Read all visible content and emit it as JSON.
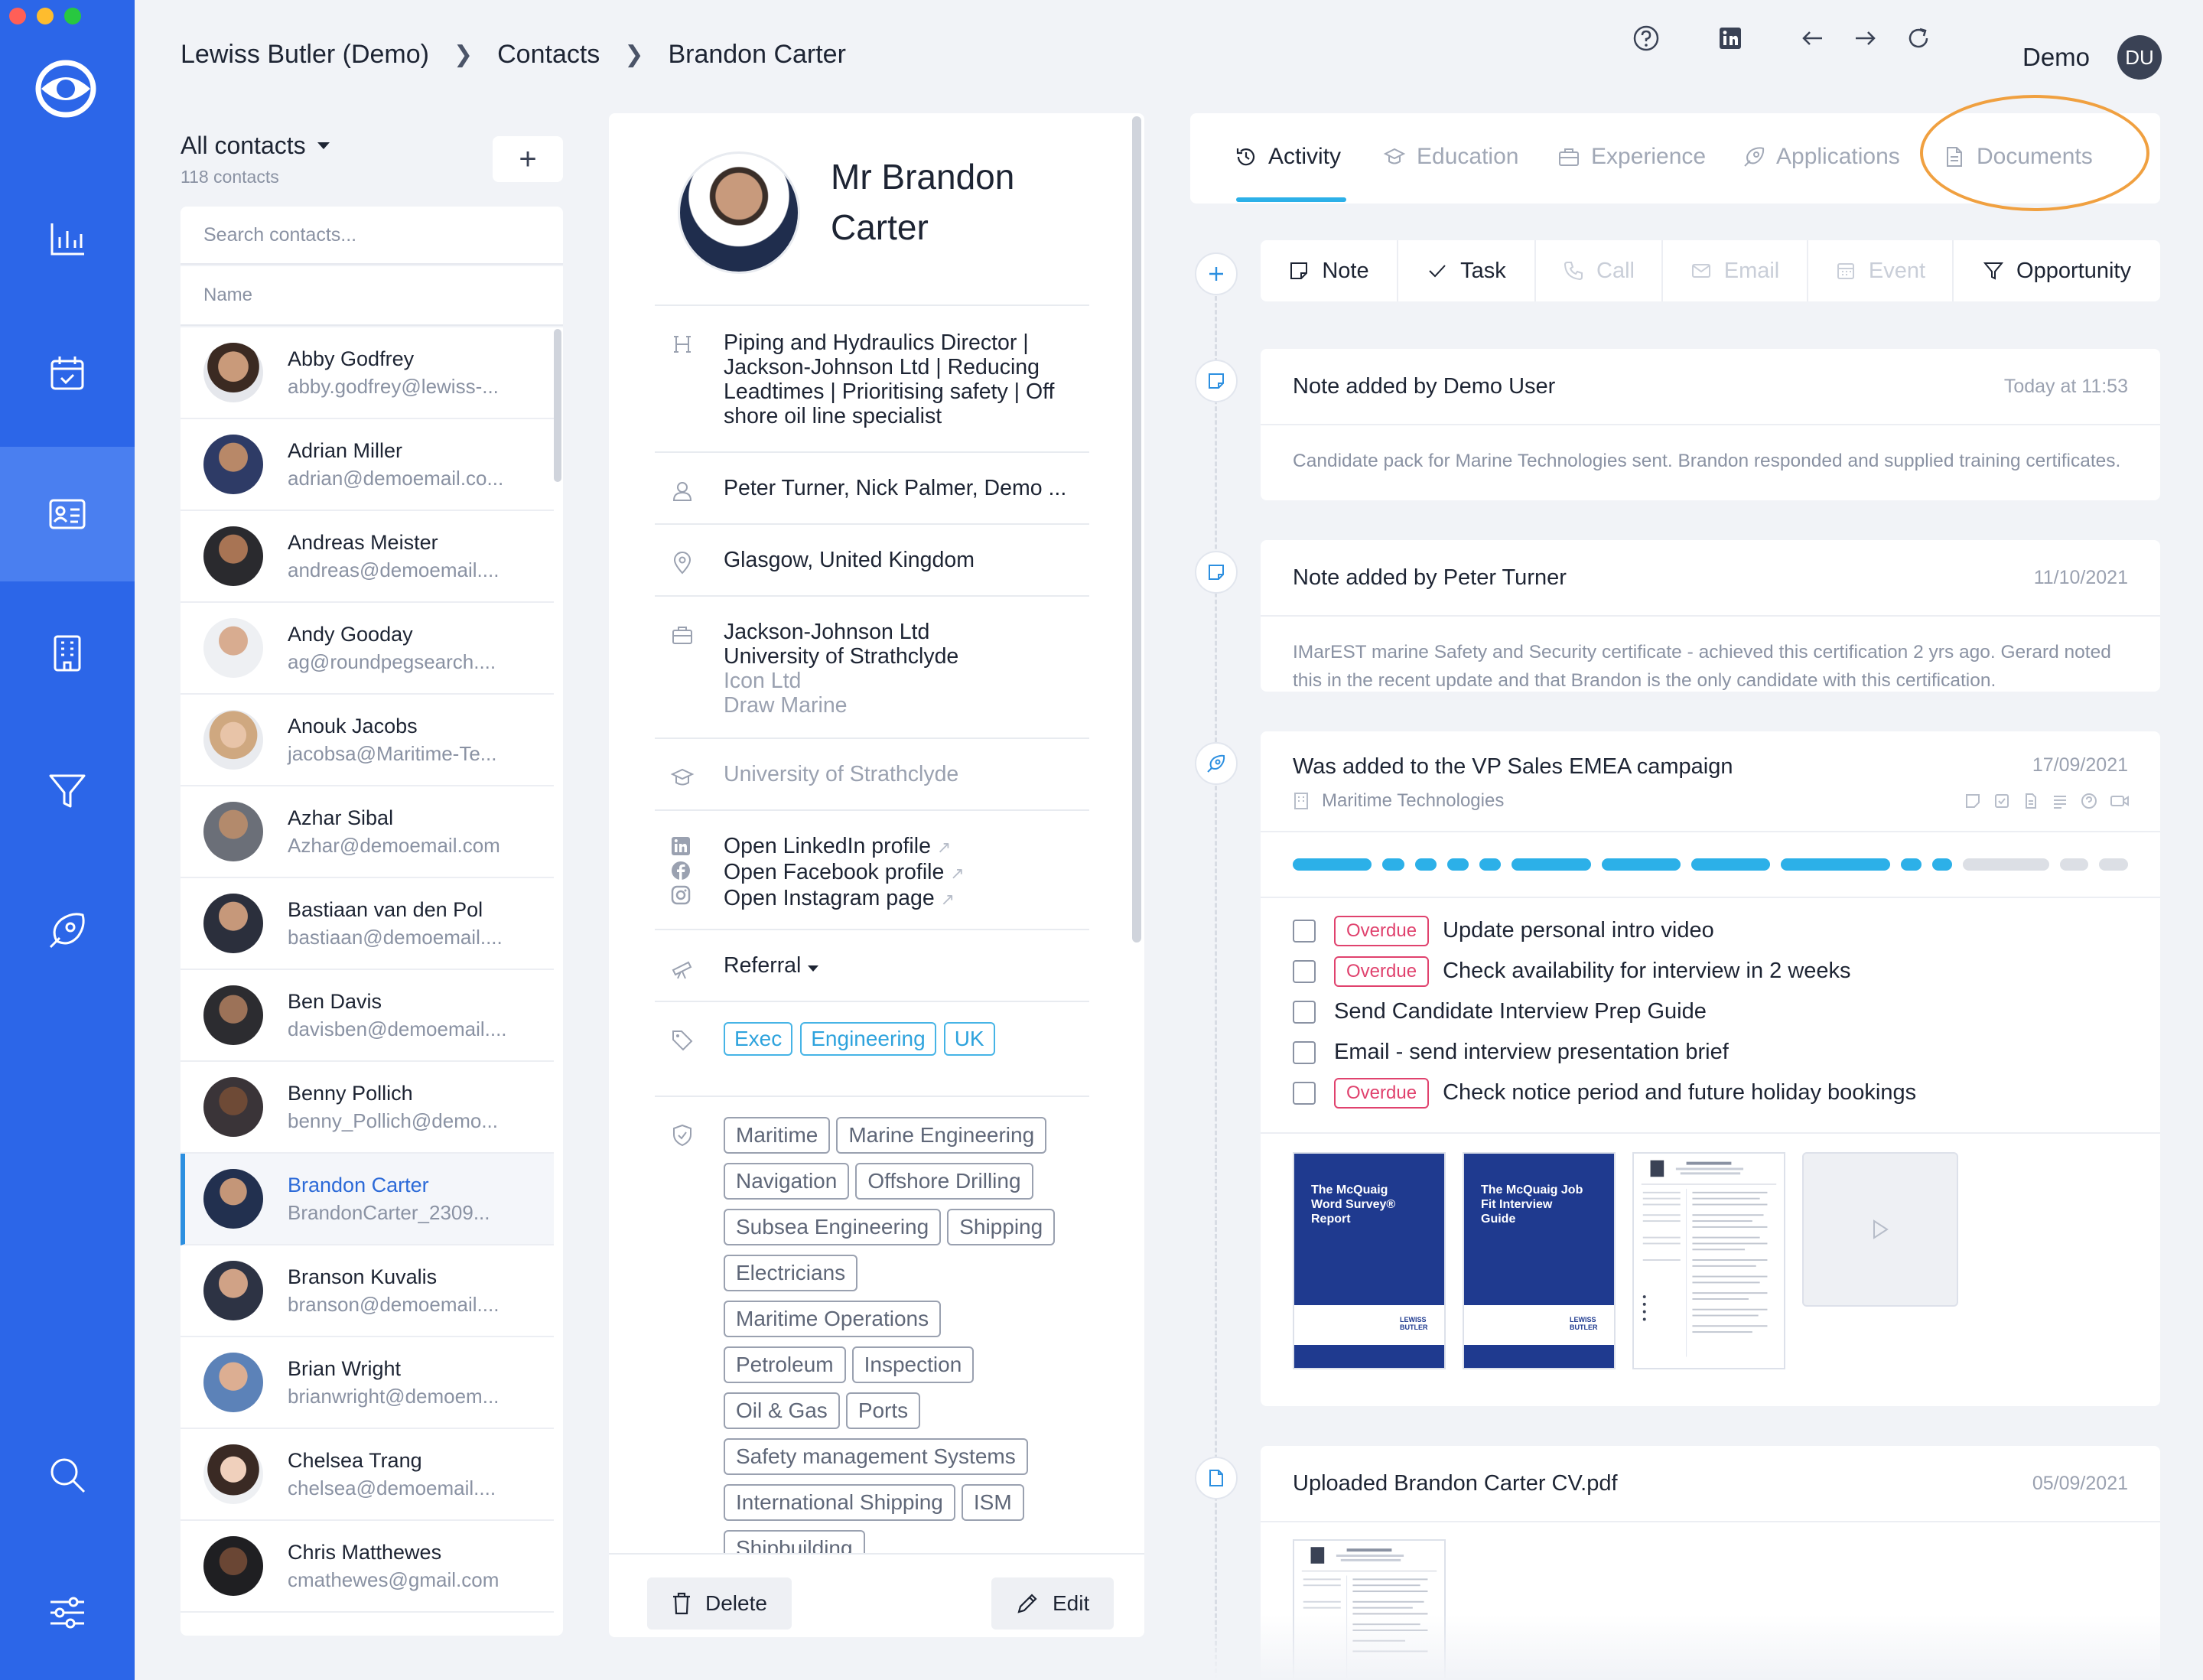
{
  "window_controls": {
    "close": "#ff5f57",
    "minimize": "#febc2e",
    "zoom": "#28c840"
  },
  "colors": {
    "rail": "#2c66e8",
    "rail_active": "#4a7ff0",
    "accent": "#2cb0e8",
    "overdue": "#e0426e",
    "highlight": "#f0a040"
  },
  "nav": [
    "logo-eye-icon",
    "reports-icon",
    "calendar-icon",
    "contacts-icon",
    "companies-icon",
    "pipeline-icon",
    "campaigns-icon",
    "search-icon",
    "settings-icon"
  ],
  "breadcrumb": {
    "account": "Lewiss Butler (Demo)",
    "section": "Contacts",
    "current": "Brandon Carter"
  },
  "topbar": {
    "user_label": "Demo",
    "user_initials": "DU"
  },
  "contacts": {
    "title": "All contacts",
    "count": "118 contacts",
    "add_label": "+",
    "search_placeholder": "Search contacts...",
    "column": "Name",
    "rows": [
      {
        "name": "Abby Godfrey",
        "email": "abby.godfrey@lewiss-..."
      },
      {
        "name": "Adrian Miller",
        "email": "adrian@demoemail.co..."
      },
      {
        "name": "Andreas Meister",
        "email": "andreas@demoemail...."
      },
      {
        "name": "Andy Gooday",
        "email": "ag@roundpegsearch...."
      },
      {
        "name": "Anouk Jacobs",
        "email": "jacobsa@Maritime-Te..."
      },
      {
        "name": "Azhar Sibal",
        "email": "Azhar@demoemail.com"
      },
      {
        "name": "Bastiaan van den Pol",
        "email": "bastiaan@demoemail...."
      },
      {
        "name": "Ben Davis",
        "email": "davisben@demoemail...."
      },
      {
        "name": "Benny Pollich",
        "email": "benny_Pollich@demo..."
      },
      {
        "name": "Brandon Carter",
        "email": "BrandonCarter_2309..."
      },
      {
        "name": "Branson Kuvalis",
        "email": "branson@demoemail...."
      },
      {
        "name": "Brian Wright",
        "email": "brianwright@demoem..."
      },
      {
        "name": "Chelsea Trang",
        "email": "chelsea@demoemail...."
      },
      {
        "name": "Chris Matthewes",
        "email": "cmathewes@gmail.com"
      }
    ]
  },
  "profile": {
    "name": "Mr Brandon Carter",
    "headline": "Piping and Hydraulics Director | Jackson-Johnson Ltd | Reducing Leadtimes | Prioritising safety | Off shore oil line specialist",
    "owners": "Peter Turner, Nick Palmer, Demo ...",
    "location": "Glasgow, United Kingdom",
    "companies": {
      "current": [
        "Jackson-Johnson Ltd",
        "University of Strathclyde"
      ],
      "past": [
        "Icon Ltd",
        "Draw Marine"
      ]
    },
    "education": "University of Strathclyde",
    "links": [
      "Open LinkedIn profile",
      "Open Facebook profile",
      "Open Instagram page"
    ],
    "source": "Referral",
    "tags": [
      "Exec",
      "Engineering",
      "UK"
    ],
    "skills": [
      "Maritime",
      "Marine Engineering",
      "Navigation",
      "Offshore Drilling",
      "Subsea Engineering",
      "Shipping",
      "Electricians",
      "Maritime Operations",
      "Petroleum",
      "Inspection",
      "Oil & Gas",
      "Ports",
      "Safety management Systems",
      "International Shipping",
      "ISM",
      "Shipbuilding"
    ],
    "delete_label": "Delete",
    "edit_label": "Edit"
  },
  "tabs": [
    {
      "label": "Activity",
      "icon": "history-icon",
      "active": true
    },
    {
      "label": "Education",
      "icon": "graduation-icon",
      "active": false
    },
    {
      "label": "Experience",
      "icon": "briefcase-icon",
      "active": false
    },
    {
      "label": "Applications",
      "icon": "rocket-icon",
      "active": false
    },
    {
      "label": "Documents",
      "icon": "document-icon",
      "active": false
    }
  ],
  "actions": [
    {
      "label": "Note",
      "enabled": true
    },
    {
      "label": "Task",
      "enabled": true
    },
    {
      "label": "Call",
      "enabled": false
    },
    {
      "label": "Email",
      "enabled": false
    },
    {
      "label": "Event",
      "enabled": false
    },
    {
      "label": "Opportunity",
      "enabled": true
    }
  ],
  "activity": {
    "note1": {
      "title": "Note added by Demo User",
      "date": "Today at 11:53",
      "body": "Candidate pack for Marine Technologies sent. Brandon responded and supplied training certificates."
    },
    "note2": {
      "title": "Note added by Peter Turner",
      "date": "11/10/2021",
      "body": "IMarEST marine Safety and Security certificate - achieved this certification 2 yrs ago. Gerard noted this in the recent update and that Brandon is the only candidate with this certification."
    },
    "campaign": {
      "title": "Was added to the VP Sales EMEA campaign",
      "date": "17/09/2021",
      "company": "Maritime Technologies",
      "progress_done": 11,
      "progress_total": 15,
      "overdue_label": "Overdue",
      "tasks": [
        {
          "label": "Update personal intro video",
          "overdue": true
        },
        {
          "label": "Check availability for interview in 2 weeks",
          "overdue": true
        },
        {
          "label": "Send Candidate Interview Prep Guide",
          "overdue": false
        },
        {
          "label": "Email - send interview presentation brief",
          "overdue": false
        },
        {
          "label": "Check notice period and future holiday bookings",
          "overdue": true
        }
      ],
      "docs": [
        {
          "title": "The McQuaig Word Survey® Report"
        },
        {
          "title": "The McQuaig Job Fit Interview Guide"
        }
      ],
      "brand": "LEWISS BUTLER"
    },
    "upload": {
      "title": "Uploaded Brandon Carter CV.pdf",
      "date": "05/09/2021"
    }
  }
}
